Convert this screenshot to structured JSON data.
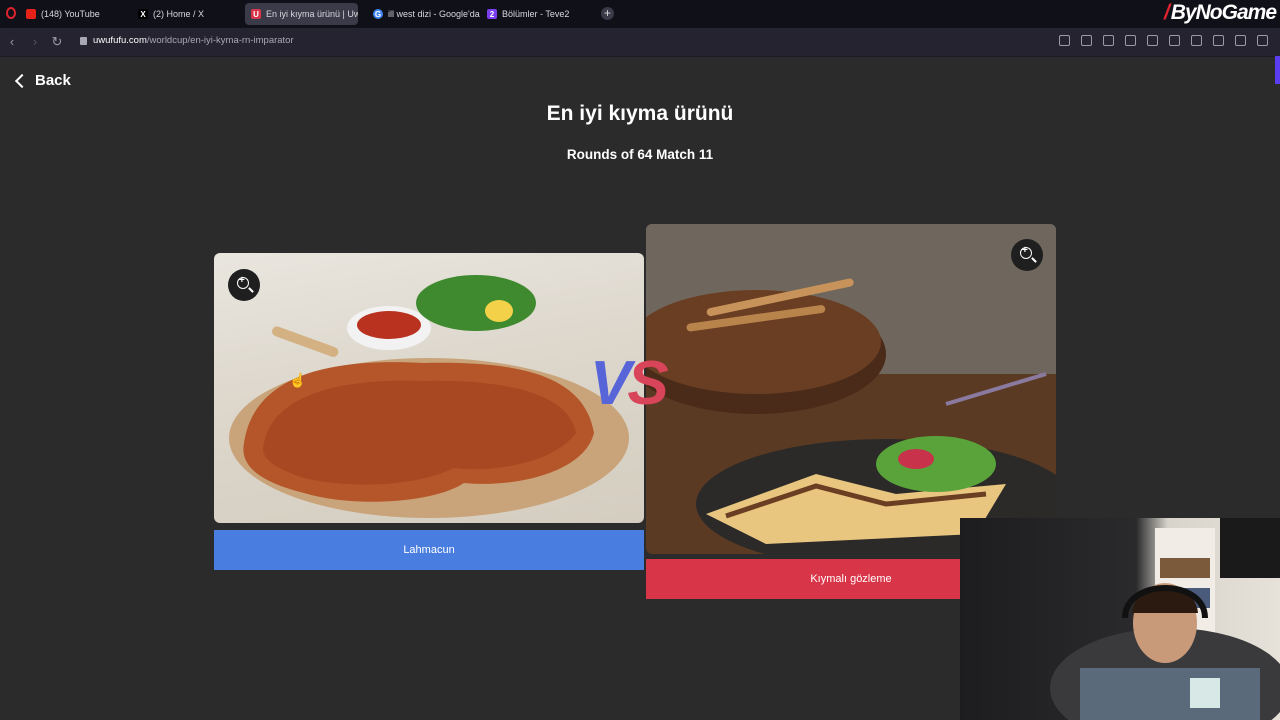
{
  "browser": {
    "tabs": [
      {
        "label": "(148) YouTube",
        "favicon_color": "#e62117",
        "active": false
      },
      {
        "label": "(2) Home / X",
        "favicon_color": "#000000",
        "active": false
      },
      {
        "label": "En iyi kıyma ürünü | UwU",
        "favicon_color": "#d93548",
        "active": true
      },
      {
        "label": "ill west dizi - Google'da A",
        "favicon_color": "#4285f4",
        "active": false
      },
      {
        "label": "Bölümler - Teve2",
        "favicon_color": "#7a3df0",
        "active": false
      }
    ],
    "new_tab_label": "+",
    "url_host": "uwufufu.com",
    "url_path": "/worldcup/en-iyi-kyma-rn-imparator",
    "overlay_brand": "ByNoGame"
  },
  "page": {
    "back_label": "Back",
    "title": "En iyi kıyma ürünü",
    "round_info": "Rounds of 64 Match 11",
    "vs_v": "V",
    "vs_s": "S",
    "left_choice": {
      "label": "Lahmacun",
      "button_color": "#4a7de0"
    },
    "right_choice": {
      "label": "Kıymalı gözleme",
      "button_color": "#d93548"
    }
  }
}
